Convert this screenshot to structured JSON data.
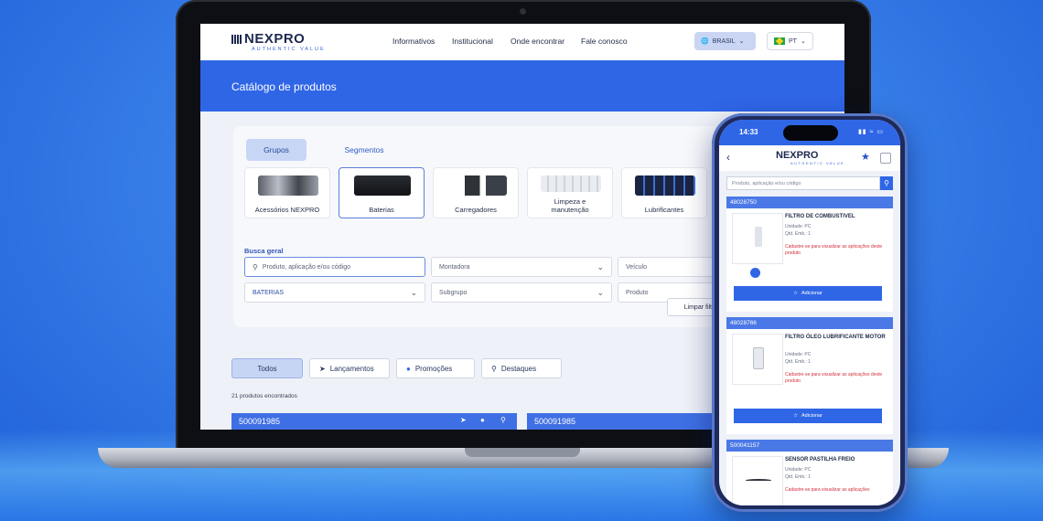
{
  "desktop": {
    "brand": {
      "name": "NEXPRO",
      "tagline": "AUTHENTIC VALUE"
    },
    "nav": [
      "Informativos",
      "Institucional",
      "Onde encontrar",
      "Fale conosco"
    ],
    "region": {
      "label": "BRASIL"
    },
    "language": {
      "label": "PT"
    },
    "hero_title": "Catálogo de produtos",
    "tabs": [
      {
        "label": "Grupos"
      },
      {
        "label": "Segmentos"
      }
    ],
    "groups": [
      {
        "label": "Acessórios NEXPRO"
      },
      {
        "label": "Baterias"
      },
      {
        "label": "Carregadores"
      },
      {
        "label": "Limpeza e manutenção"
      },
      {
        "label": "Lubrificantes"
      }
    ],
    "busca_label": "Busca geral",
    "search_placeholder": "Produto, aplicação e/ou código",
    "selects": {
      "montadora": "Montadora",
      "veiculo": "Veículo",
      "grupo": "BATERIAS",
      "subgrupo": "Subgrupo",
      "produto": "Produto"
    },
    "clear_button": "Limpar filtr",
    "filters": [
      {
        "label": "Todos"
      },
      {
        "label": "Lançamentos"
      },
      {
        "label": "Promoções"
      },
      {
        "label": "Destaques"
      }
    ],
    "results_count": "21 produtos encontrados",
    "product_codes": [
      "500091985",
      "500091985"
    ]
  },
  "mobile": {
    "time": "14:33",
    "brand": {
      "name": "NEXPRO",
      "tagline": "AUTHENTIC VALUE"
    },
    "search_placeholder": "Produto, aplicação e/ou código",
    "items": [
      {
        "code": "48028750",
        "name": "FILTRO DE COMBUSTIVEL",
        "unidade": "Unidade: PC",
        "qtd": "Qtd. Emb.: 1",
        "warning": "Cadastre-se para visualizar as aplicações deste produto",
        "add_label": "Adicionar"
      },
      {
        "code": "48028766",
        "name": "FILTRO ÓLEO LUBRIFICANTE MOTOR",
        "unidade": "Unidade: PC",
        "qtd": "Qtd. Emb.: 1",
        "warning": "Cadastre-se para visualizar as aplicações deste produto",
        "add_label": "Adicionar"
      },
      {
        "code": "500041157",
        "name": "SENSOR PASTILHA FREIO",
        "unidade": "Unidade: PC",
        "qtd": "Qtd. Emb.: 1",
        "warning": "Cadastre-se para visualizar as aplicações",
        "add_label": "Adicionar"
      }
    ]
  },
  "colors": {
    "primary": "#2f66e6",
    "navy": "#1d2a50",
    "warning": "#d1303a",
    "selected_tab": "#c8d6f6"
  }
}
